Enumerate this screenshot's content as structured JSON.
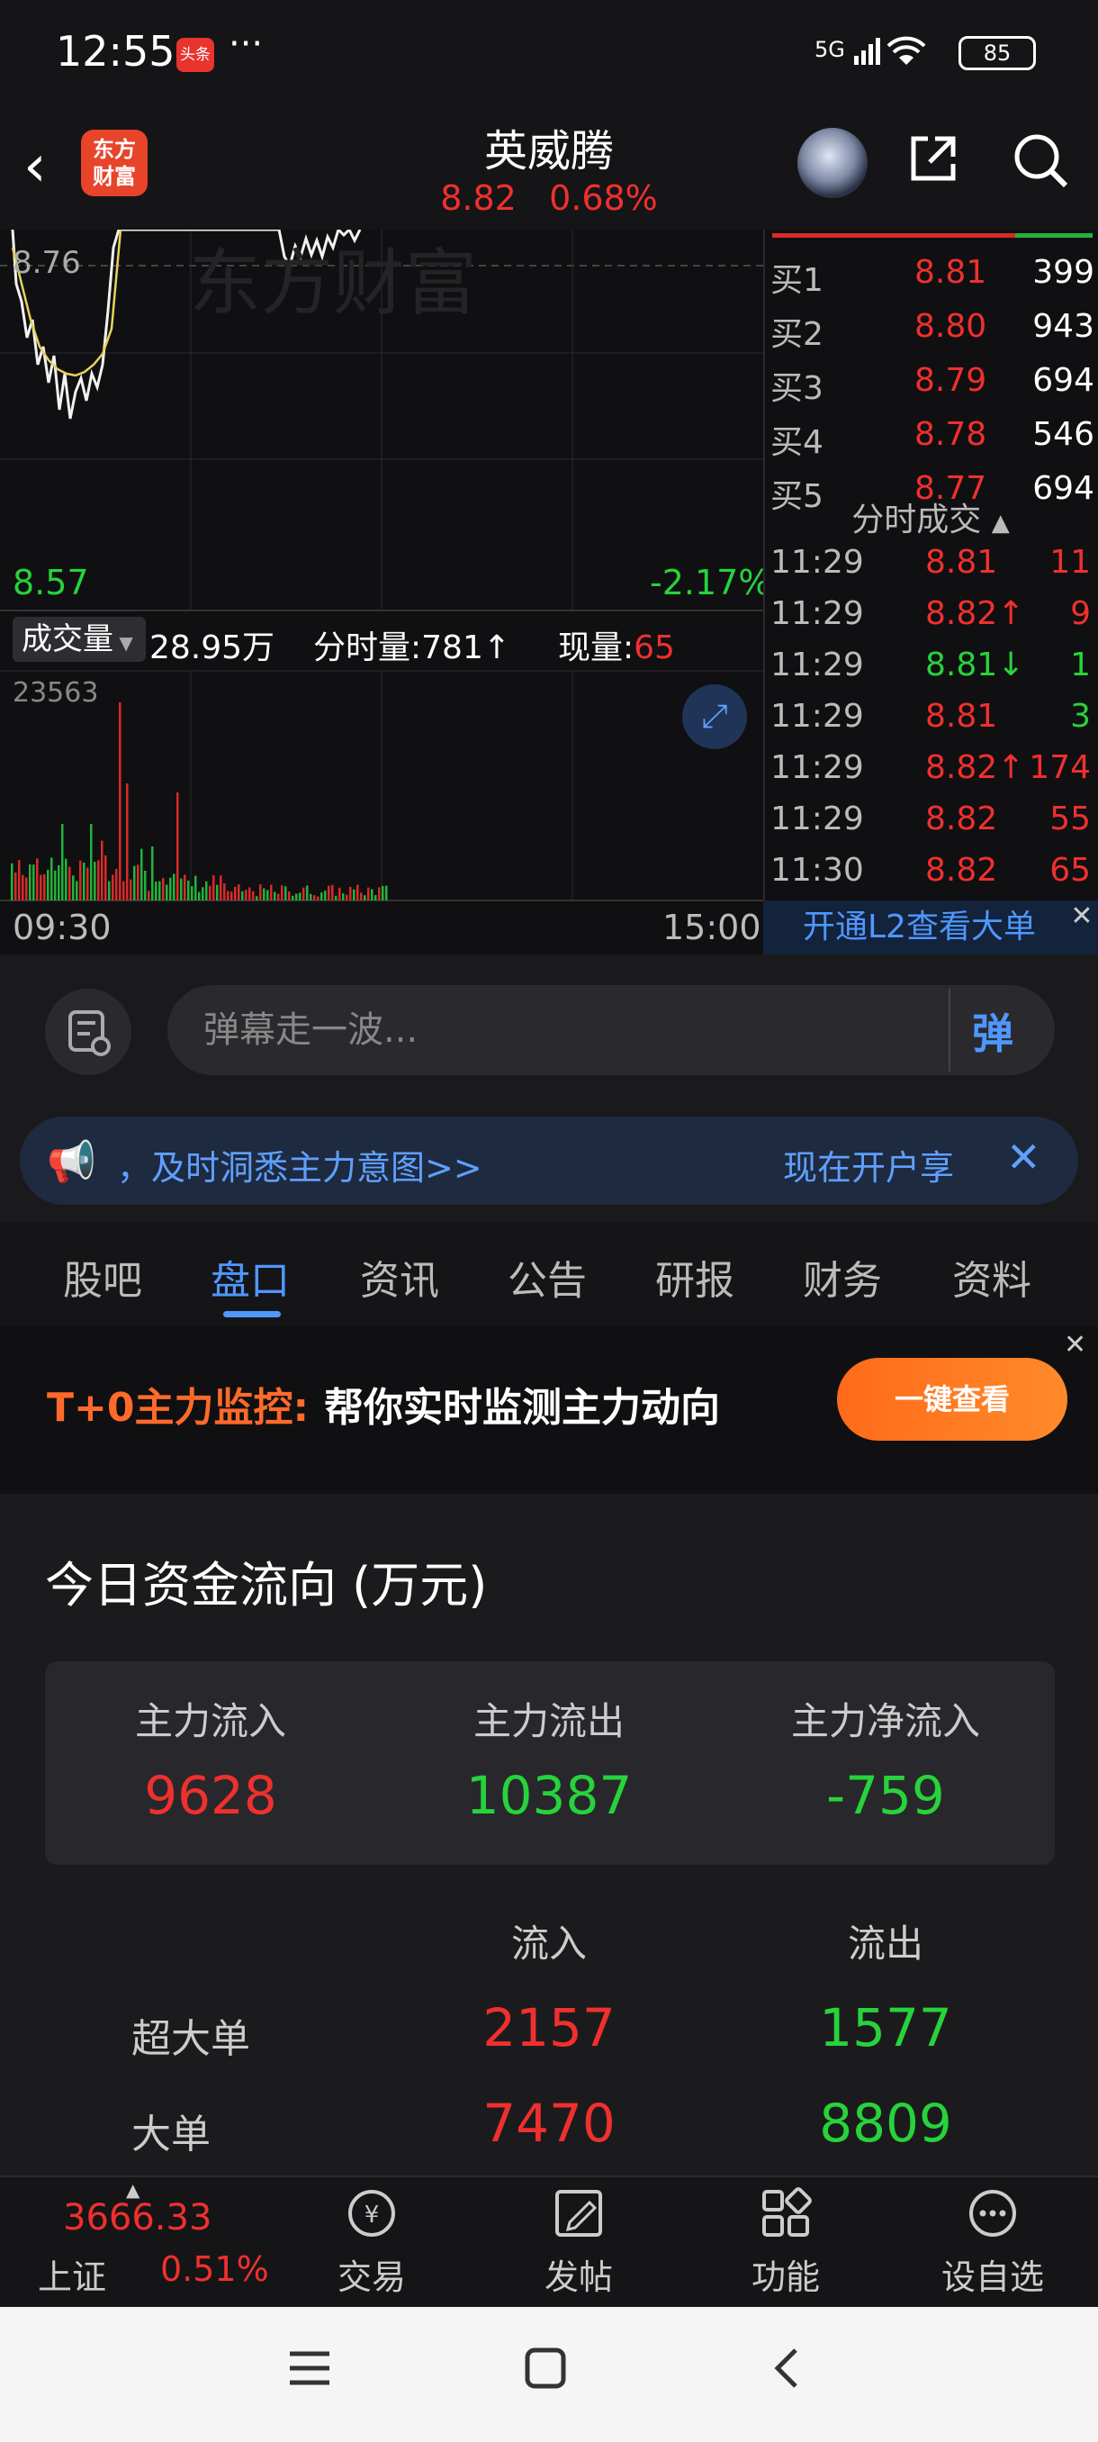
{
  "status_bar": {
    "time": "12:55",
    "app_badge": "头条",
    "more": "···",
    "network": "5G",
    "battery": "85"
  },
  "header": {
    "logo": "东方\n财富",
    "title": "英威腾",
    "price": "8.82",
    "change_pct": "0.68%"
  },
  "chart": {
    "watermark": "东方财富",
    "level_top": "8.76",
    "level_bottom": "8.57",
    "pct_bottom": "-2.17%",
    "volume_label": "成交量",
    "volume_value": "28.95万",
    "fenshi_label": "分时量:781↑",
    "xianliang_label": "现量:",
    "xianliang_value": "65",
    "volume_max": "23563",
    "time_start": "09:30",
    "time_end": "15:00"
  },
  "order_book": {
    "bids": [
      {
        "label": "买1",
        "price": "8.81",
        "volume": "399"
      },
      {
        "label": "买2",
        "price": "8.80",
        "volume": "943"
      },
      {
        "label": "买3",
        "price": "8.79",
        "volume": "694"
      },
      {
        "label": "买4",
        "price": "8.78",
        "volume": "546"
      },
      {
        "label": "买5",
        "price": "8.77",
        "volume": "694"
      }
    ],
    "ticks_title": "分时成交",
    "ticks": [
      {
        "time": "11:29",
        "price": "8.81",
        "arrow": "",
        "volume": "11",
        "color": "red"
      },
      {
        "time": "11:29",
        "price": "8.82↑",
        "arrow": "up",
        "volume": "9",
        "color": "red"
      },
      {
        "time": "11:29",
        "price": "8.81↓",
        "arrow": "down",
        "volume": "1",
        "color": "green"
      },
      {
        "time": "11:29",
        "price": "8.81",
        "arrow": "",
        "volume": "3",
        "color": "green"
      },
      {
        "time": "11:29",
        "price": "8.82↑",
        "arrow": "up",
        "volume": "174",
        "color": "red"
      },
      {
        "time": "11:29",
        "price": "8.82",
        "arrow": "",
        "volume": "55",
        "color": "red"
      },
      {
        "time": "11:30",
        "price": "8.82",
        "arrow": "",
        "volume": "65",
        "color": "red"
      }
    ],
    "l2_text": "开通L2查看大单"
  },
  "danmu": {
    "placeholder": "弹幕走一波...",
    "button": "弹"
  },
  "promo": {
    "text": "，及时洞悉主力意图>>",
    "open": "现在开户享"
  },
  "tabs": [
    "股吧",
    "盘口",
    "资讯",
    "公告",
    "研报",
    "财务",
    "资料"
  ],
  "active_tab": "盘口",
  "ad": {
    "highlight": "T+0主力监控:",
    "text": "帮你实时监测主力动向",
    "button": "一键查看"
  },
  "funds": {
    "title": "今日资金流向 (万元)",
    "summary": [
      {
        "label": "主力流入",
        "value": "9628",
        "color": "red"
      },
      {
        "label": "主力流出",
        "value": "10387",
        "color": "green"
      },
      {
        "label": "主力净流入",
        "value": "-759",
        "color": "green"
      }
    ],
    "headers": [
      "流入",
      "流出"
    ],
    "rows": [
      {
        "label": "超大单",
        "inflow": "2157",
        "outflow": "1577"
      },
      {
        "label": "大单",
        "inflow": "7470",
        "outflow": "8809"
      }
    ]
  },
  "bottom_nav": {
    "index_value": "3666.33",
    "index_name": "上证",
    "index_pct": "0.51%",
    "items": [
      "交易",
      "发帖",
      "功能",
      "设自选"
    ]
  },
  "colors": {
    "up": "#f0302e",
    "down": "#27d33b",
    "accent": "#4f97ff",
    "background": "#1a1a1c"
  }
}
